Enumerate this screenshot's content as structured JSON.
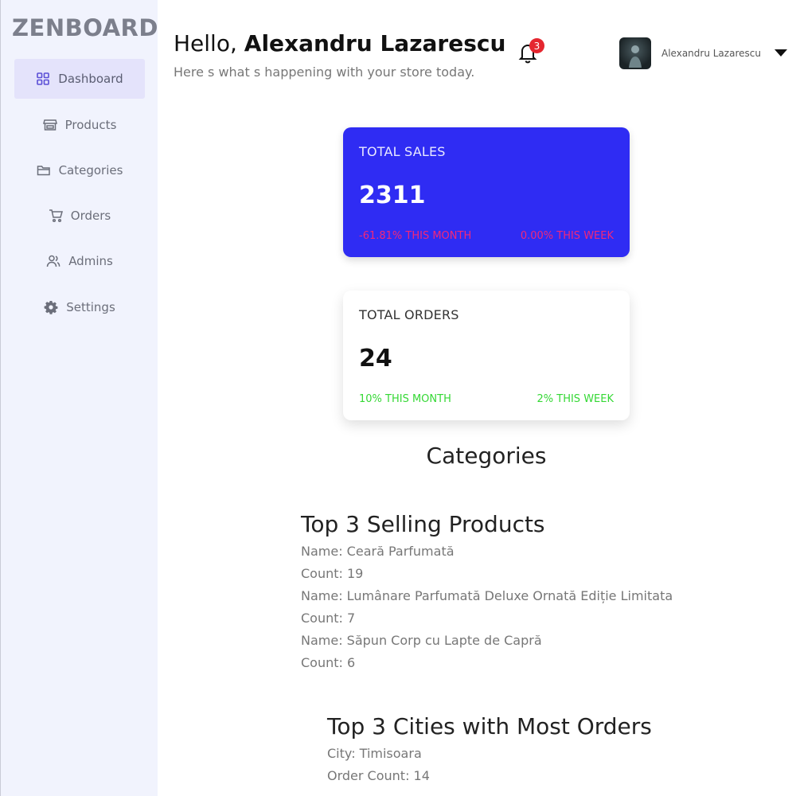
{
  "brand": "ZENBOARD",
  "sidebar": {
    "items": [
      {
        "label": "Dashboard",
        "icon": "grid-icon",
        "active": true
      },
      {
        "label": "Products",
        "icon": "store-icon",
        "active": false
      },
      {
        "label": "Categories",
        "icon": "folder-icon",
        "active": false
      },
      {
        "label": "Orders",
        "icon": "cart-icon",
        "active": false
      },
      {
        "label": "Admins",
        "icon": "users-icon",
        "active": false
      },
      {
        "label": "Settings",
        "icon": "gear-icon",
        "active": false
      }
    ]
  },
  "header": {
    "greeting_prefix": "Hello, ",
    "user_name": "Alexandru Lazarescu",
    "subtitle": "Here s what s happening with your store today.",
    "notification_count": "3",
    "profile_name": "Alexandru Lazarescu"
  },
  "cards": {
    "sales": {
      "title": "TOTAL SALES",
      "value": "2311",
      "month": "-61.81% THIS MONTH",
      "week": "0.00% THIS WEEK"
    },
    "orders": {
      "title": "TOTAL ORDERS",
      "value": "24",
      "month": "10% THIS MONTH",
      "week": "2% THIS WEEK"
    }
  },
  "categories_heading": "Categories",
  "top_products": {
    "heading": "Top 3 Selling Products",
    "items": [
      {
        "name": "Name: Ceară Parfumată",
        "count": "Count: 19"
      },
      {
        "name": "Name: Lumânare Parfumată Deluxe Ornată Ediție Limitata",
        "count": "Count: 7"
      },
      {
        "name": "Name: Săpun Corp cu Lapte de Capră",
        "count": "Count: 6"
      }
    ]
  },
  "top_cities": {
    "heading": "Top 3 Cities with Most Orders",
    "items": [
      {
        "city": "City: Timisoara",
        "count": "Order Count: 14"
      }
    ]
  },
  "colors": {
    "accent": "#2f2cf3",
    "sidebar_bg": "#f1f3fd",
    "negative": "#f2277a",
    "positive": "#35d835",
    "badge": "#e5262f"
  }
}
